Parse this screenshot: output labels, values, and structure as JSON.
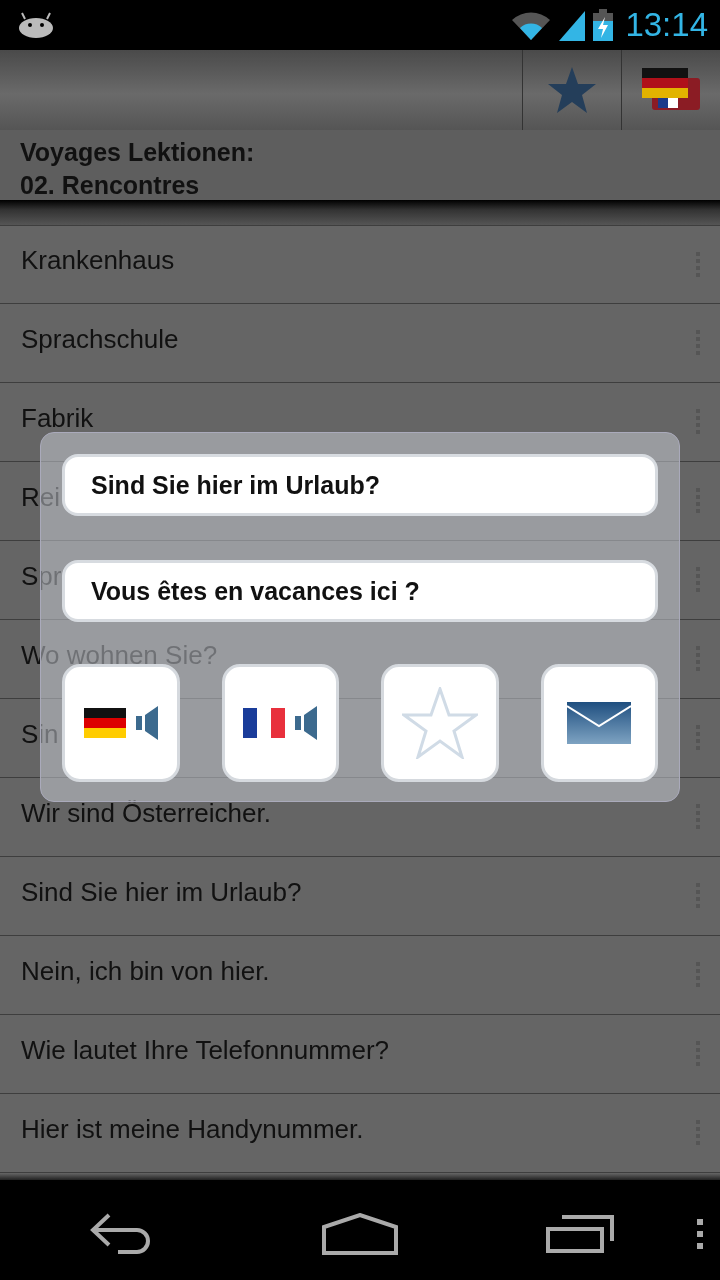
{
  "status_bar": {
    "time": "13:14"
  },
  "header": {
    "line_1": "Voyages Lektionen:",
    "line_2": "02. Rencontres"
  },
  "rows": [
    {
      "text": "Krankenhaus"
    },
    {
      "text": "Sprachschule"
    },
    {
      "text": "Fabrik"
    },
    {
      "text": "Rei"
    },
    {
      "text": "Spr"
    },
    {
      "text": "Wo wohnen Sie?"
    },
    {
      "text": "Sin"
    },
    {
      "text": "Wir sind Österreicher."
    },
    {
      "text": "Sind Sie hier im Urlaub?"
    },
    {
      "text": "Nein, ich bin von hier."
    },
    {
      "text": "Wie lautet Ihre Telefonnummer?"
    },
    {
      "text": "Hier ist meine Handynummer."
    }
  ],
  "dialog": {
    "fields": [
      "Sind Sie hier im Urlaub?",
      "Vous êtes en vacances ici ?"
    ],
    "buttons": [
      {
        "kind": "speak-german"
      },
      {
        "kind": "speak-french"
      },
      {
        "kind": "favorite"
      },
      {
        "kind": "email"
      }
    ]
  }
}
